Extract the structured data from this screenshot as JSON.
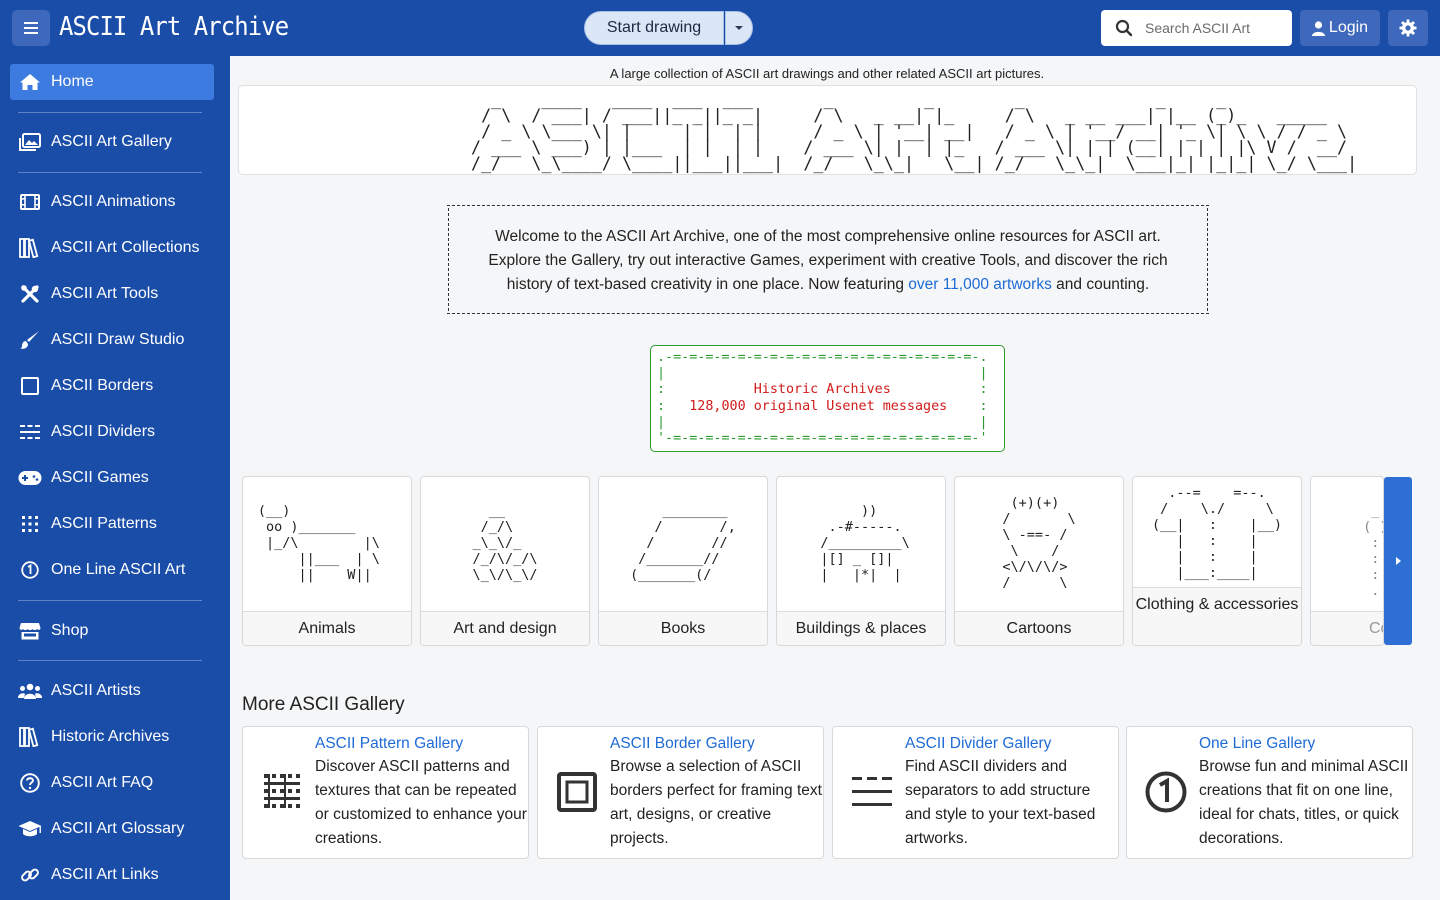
{
  "header": {
    "brand": "ASCII Art Archive",
    "start_drawing": "Start drawing",
    "search_placeholder": "Search ASCII Art",
    "login": "Login"
  },
  "sidebar": {
    "items": [
      {
        "label": "Home",
        "icon": "home-icon",
        "active": true
      },
      {
        "label": "ASCII Art Gallery",
        "icon": "gallery-icon"
      },
      {
        "label": "ASCII Animations",
        "icon": "film-icon"
      },
      {
        "label": "ASCII Art Collections",
        "icon": "books-icon"
      },
      {
        "label": "ASCII Art Tools",
        "icon": "tools-icon"
      },
      {
        "label": "ASCII Draw Studio",
        "icon": "brush-icon"
      },
      {
        "label": "ASCII Borders",
        "icon": "square-icon"
      },
      {
        "label": "ASCII Dividers",
        "icon": "dividers-icon"
      },
      {
        "label": "ASCII Games",
        "icon": "gamepad-icon"
      },
      {
        "label": "ASCII Patterns",
        "icon": "grid-dots-icon"
      },
      {
        "label": "One Line ASCII Art",
        "icon": "circle-one-icon"
      },
      {
        "label": "Shop",
        "icon": "shop-icon"
      },
      {
        "label": "ASCII Artists",
        "icon": "users-icon"
      },
      {
        "label": "Historic Archives",
        "icon": "archive-books-icon"
      },
      {
        "label": "ASCII Art FAQ",
        "icon": "question-icon"
      },
      {
        "label": "ASCII Art Glossary",
        "icon": "graduation-cap-icon"
      },
      {
        "label": "ASCII Art Links",
        "icon": "link-icon"
      }
    ]
  },
  "main": {
    "tagline": "A large collection of ASCII art drawings and other related ASCII art pictures.",
    "banner_ascii": "  _    ____   ____  ___  ___       _         _        _             _     _             \n / \\  / ___| / ___||_ _||_ _|     / \\   _ __| |_     / \\   _ __ ___| |__ (_)_   _____ \n / _ \\ \\___ \\| |     | |  | |     / _ \\ | '__| __|   / _ \\ | '__/ __| '_ \\| \\ \\ / / _ \\\n/ ___ \\ ___) | |___  | |  | |    / ___ \\| |  | |_   / ___ \\| | | (__| | | | |\\ V /  __/\n/_/   \\_\\____/ \\____||___||___|  /_/   \\_\\_|   \\__| /_/   \\_\\_|  \\___|_| |_|_| \\_/ \\___|",
    "welcome_text": "Welcome to the ASCII Art Archive, one of the most comprehensive online resources for ASCII art. Explore the Gallery, try out interactive Games, experiment with creative Tools, and discover the rich history of text-based creativity in one place. Now featuring ",
    "welcome_link": "over 11,000 artworks",
    "welcome_tail": " and counting.",
    "historic": {
      "border_top": ".-=-=-=-=-=-=-=-=-=-=-=-=-=-=-=-=-=-=-=-.",
      "title": "Historic Archives",
      "subtitle": "128,000 original Usenet messages",
      "border_bottom": "'-=-=-=-=-=-=-=-=-=-=-=-=-=-=-=-=-=-=-=-'"
    },
    "categories": [
      {
        "label": "Animals",
        "ascii": "(__)            \n oo )_______    \n |_/\\        |\\  \n     ||___  | \\ \n     ||    W||  "
      },
      {
        "label": "Art and design",
        "ascii": "  __    \n /_/\\   \n_\\_\\/_  \n/_/\\/_/\\\n\\_\\/\\_\\/"
      },
      {
        "label": "Books",
        "ascii": "    ________ \n   /       /,\n  /       // \n /_______//  \n(_______(/   "
      },
      {
        "label": "Buildings & places",
        "ascii": "      ))   \n  .-#-----.\n /_________\\\n |[] _ []| \n |   |*|  | "
      },
      {
        "label": "Cartoons",
        "ascii": "  (+)(+)  \n /       \\ \n \\ -==- / \n  \\    /  \n <\\/\\/\\/> \n /      \\ "
      },
      {
        "label": "Clothing & accessories",
        "ascii": "  .--=    =--.  \n /    \\./     \\ \n(__|   :    |__)\n   |   :    |   \n   |   :    |   \n   |___:____|   "
      },
      {
        "label": "Computers",
        "ascii": "  _  \n ( ) \n  : \n  : \n  : \n  . "
      }
    ],
    "more_title": "More ASCII Gallery",
    "galleries": [
      {
        "title": "ASCII Pattern Gallery",
        "desc": "Discover ASCII patterns and textures that can be repeated or customized to enhance your creations.",
        "icon": "pattern-icon"
      },
      {
        "title": "ASCII Border Gallery",
        "desc": "Browse a selection of ASCII borders perfect for framing text art, designs, or creative projects.",
        "icon": "border-icon"
      },
      {
        "title": "ASCII Divider Gallery",
        "desc": "Find ASCII dividers and separators to add structure and style to your text-based artworks.",
        "icon": "divider-icon"
      },
      {
        "title": "One Line Gallery",
        "desc": "Browse fun and minimal ASCII creations that fit on one line, ideal for chats, titles, or quick decorations.",
        "icon": "one-line-icon"
      }
    ]
  },
  "colors": {
    "primary": "#1a4da8",
    "active": "#3d7be0",
    "link": "#1f6bd6",
    "green": "#2e9a2e",
    "red": "#d21b1b"
  }
}
